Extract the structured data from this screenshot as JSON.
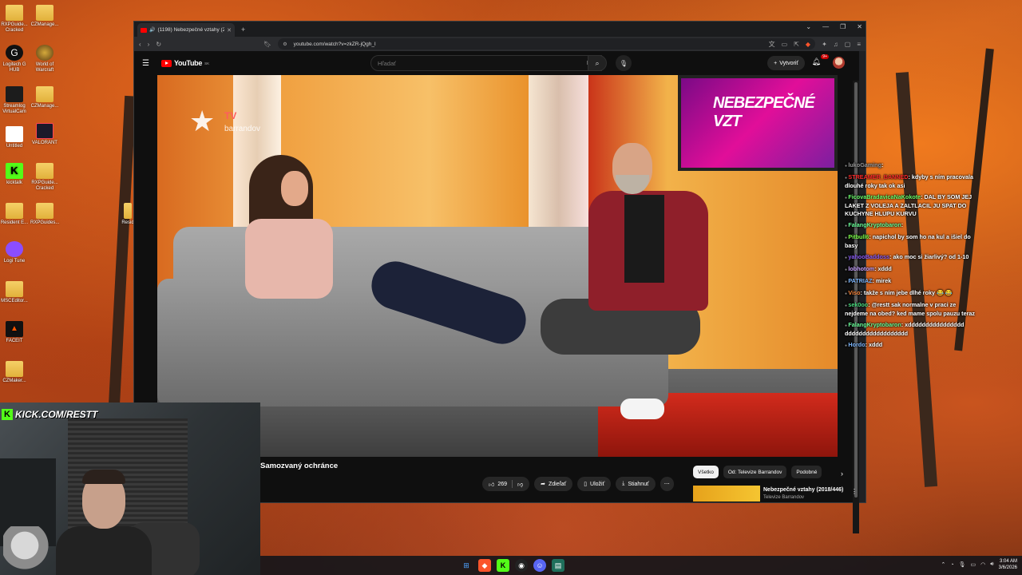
{
  "desktop": {
    "icons": [
      {
        "label": "RXPGuide... Cracked",
        "kind": "folder"
      },
      {
        "label": "CZManage...",
        "kind": "folder"
      },
      {
        "label": "Logitech G HUB",
        "kind": "app"
      },
      {
        "label": "World of Warcraft",
        "kind": "app"
      },
      {
        "label": "Streamlog VirtualCam",
        "kind": "app"
      },
      {
        "label": "CZManage...",
        "kind": "folder"
      },
      {
        "label": "Untitled",
        "kind": "file"
      },
      {
        "label": "VALORANT",
        "kind": "app"
      },
      {
        "label": "kicktalk",
        "kind": "app"
      },
      {
        "label": "RXPGuide... Cracked",
        "kind": "folder"
      },
      {
        "label": "Resident E...",
        "kind": "folder"
      },
      {
        "label": "RXPGuides...",
        "kind": "folder"
      },
      {
        "label": "Logi Tune",
        "kind": "app"
      },
      {
        "label": "MSCEditor...",
        "kind": "folder"
      },
      {
        "label": "FACEIT",
        "kind": "app"
      },
      {
        "label": "CZMaker...",
        "kind": "folder"
      }
    ],
    "partial_icon_label": "Resid"
  },
  "browser": {
    "tab_title": "(1198) Nebezpečné vztahy (2",
    "new_tab": "+",
    "url": "youtube.com/watch?v=zkZR-jQgh_I"
  },
  "youtube": {
    "logo_text": "YouTube",
    "region": "SK",
    "search_placeholder": "Hľadať",
    "create_label": "Vytvoriť",
    "notif_badge": "9+",
    "video_title": "Samozvaný ochránce",
    "actions": {
      "likes": "269",
      "share": "Zdieľať",
      "save": "Uložiť",
      "download": "Stiahnuť",
      "more": "⋯"
    },
    "chips": [
      "Všetko",
      "Od: Televize Barrandov",
      "Podobné"
    ],
    "recommended": {
      "title": "Nebezpečné vztahy (2018/446)",
      "channel": "Televize Barrandov"
    }
  },
  "video_overlay": {
    "logo_tv": "TV",
    "logo_name": "barrandov",
    "screen_text": "NEBEZPEČNÉ VZT"
  },
  "chat": [
    {
      "user": "lukoGaming",
      "color": "#9a9a9a",
      "text": ""
    },
    {
      "user": "STREAMER_BANNED",
      "color": "#ff2a2a",
      "text": "kdyby s ním pracovala dlouhé roky tak ok asi"
    },
    {
      "user": "FicovaBradavicaNaKokote",
      "color": "#6bff6b",
      "text": "DAL BY SOM JEJ LAKET Z VOLEJA A ZALTLACIL JU SPAT DO KUCHYNE HLUPU KURVU"
    },
    {
      "user": "FalangKryptobaron",
      "color": "#6bff9a",
      "text": ""
    },
    {
      "user": "Pitbull6",
      "color": "#7dff4a",
      "text": "napichol by som ho na kul a išiel do basy"
    },
    {
      "user": "yahooBaddoss",
      "color": "#8b5cf6",
      "text": "ako moc si žiarlivý? od 1-10"
    },
    {
      "user": "lobhotom",
      "color": "#c9a3ff",
      "text": "xddd"
    },
    {
      "user": "PATRIAZ",
      "color": "#7fb8ff",
      "text": "mirek"
    },
    {
      "user": "Viso",
      "color": "#ff8a3d",
      "text": "takže s ním jebe dlhé roky 😂 😂"
    },
    {
      "user": "sek0oo",
      "color": "#4ade80",
      "text": "@restt sak normalne v praci ze nejdeme na obed? ked mame spolu pauzu teraz"
    },
    {
      "user": "FalangKryptobaron",
      "color": "#6bff9a",
      "text": "xdddddddddddddddd dddddddddddddddddd"
    },
    {
      "user": "Hordo",
      "color": "#7fb8ff",
      "text": "xddd"
    }
  ],
  "webcam": {
    "kick_label": "KICK.COM/RESTT"
  },
  "taskbar": {
    "time": "3:04 AM",
    "date": "3/6/2026"
  }
}
